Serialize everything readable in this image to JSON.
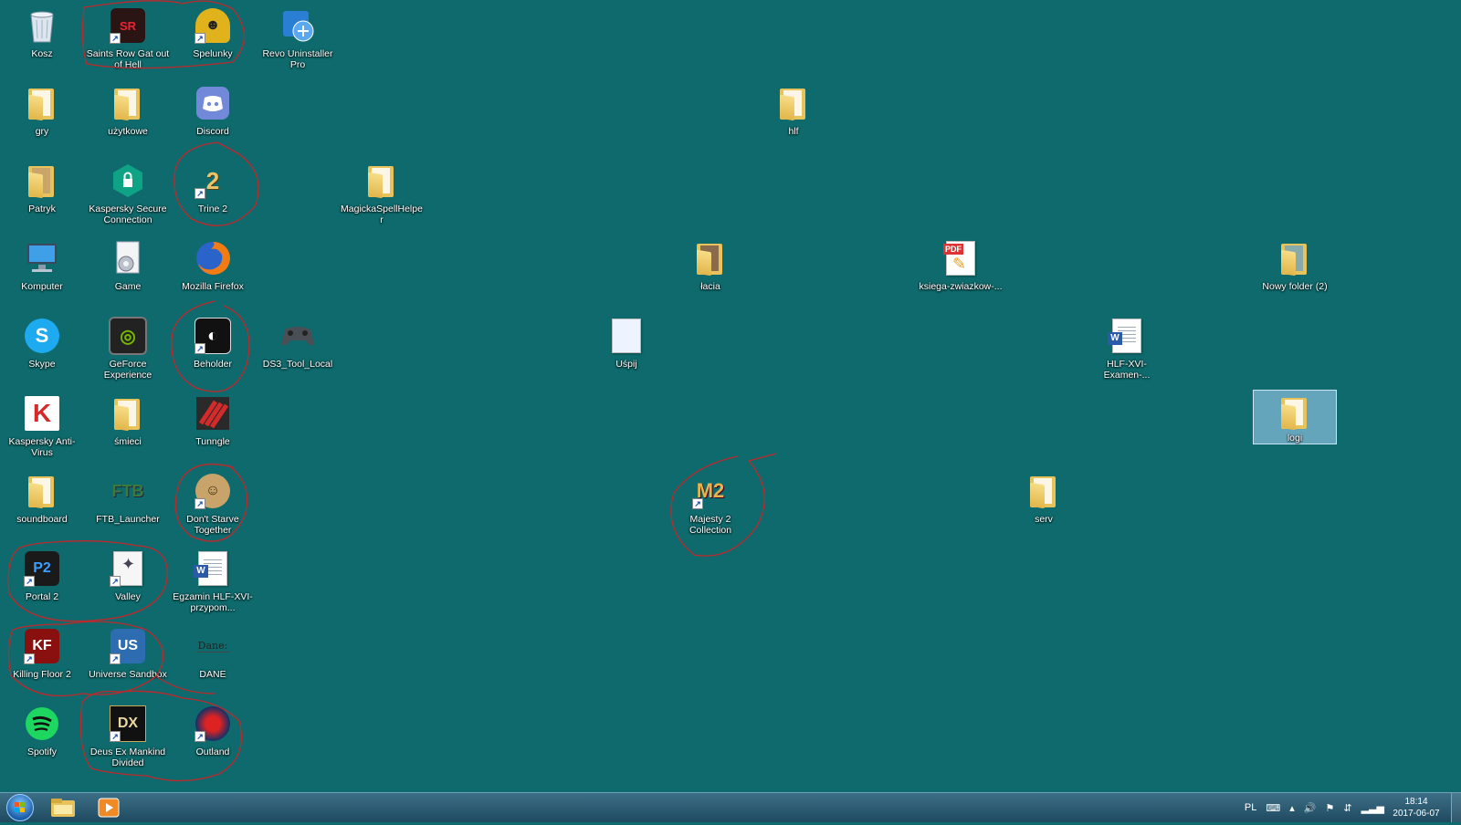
{
  "desktop": {
    "background_color": "#0e6a6c",
    "icons": {
      "kosz": "Kosz",
      "saints_row": "Saints Row Gat out of Hell",
      "spelunky": "Spelunky",
      "revo": "Revo Uninstaller Pro",
      "gry": "gry",
      "uzytkowe": "użytkowe",
      "discord": "Discord",
      "hlf": "hlf",
      "patryk": "Patryk",
      "kaspersky_secure": "Kaspersky Secure Connection",
      "trine2": "Trine 2",
      "magicka": "MagickaSpellHelper",
      "komputer": "Komputer",
      "game": "Game",
      "firefox": "Mozilla Firefox",
      "lacia": "łacia",
      "ksiega": "ksiega-zwiazkow-...",
      "nowy_folder": "Nowy folder (2)",
      "skype": "Skype",
      "geforce": "GeForce Experience",
      "beholder": "Beholder",
      "ds3tool": "DS3_Tool_Local",
      "uspij": "Uśpij",
      "hlf_examen": "HLF-XVI-Examen-...",
      "kaspersky_av": "Kaspersky Anti-Virus",
      "smieci": "śmieci",
      "tunngle": "Tunngle",
      "logi": "logi",
      "soundboard": "soundboard",
      "ftb": "FTB_Launcher",
      "dont_starve": "Don't Starve Together",
      "majesty": "Majesty 2 Collection",
      "serv": "serv",
      "portal2": "Portal 2",
      "valley": "Valley",
      "egzamin": "Egzamin HLF-XVI-przypom...",
      "killing_floor": "Killing Floor 2",
      "universe_sandbox": "Universe Sandbox",
      "dane": "DANE",
      "dane_glyph_text": "Dane:",
      "spotify": "Spotify",
      "deus_ex": "Deus Ex Mankind Divided",
      "outland": "Outland"
    },
    "selected_icon": "logi",
    "annotation_color": "#c0282c"
  },
  "taskbar": {
    "pinned": [
      "start-orb",
      "explorer-icon",
      "media-player-icon"
    ],
    "tray": {
      "language": "PL",
      "time": "18:14",
      "date": "2017-06-07"
    }
  }
}
